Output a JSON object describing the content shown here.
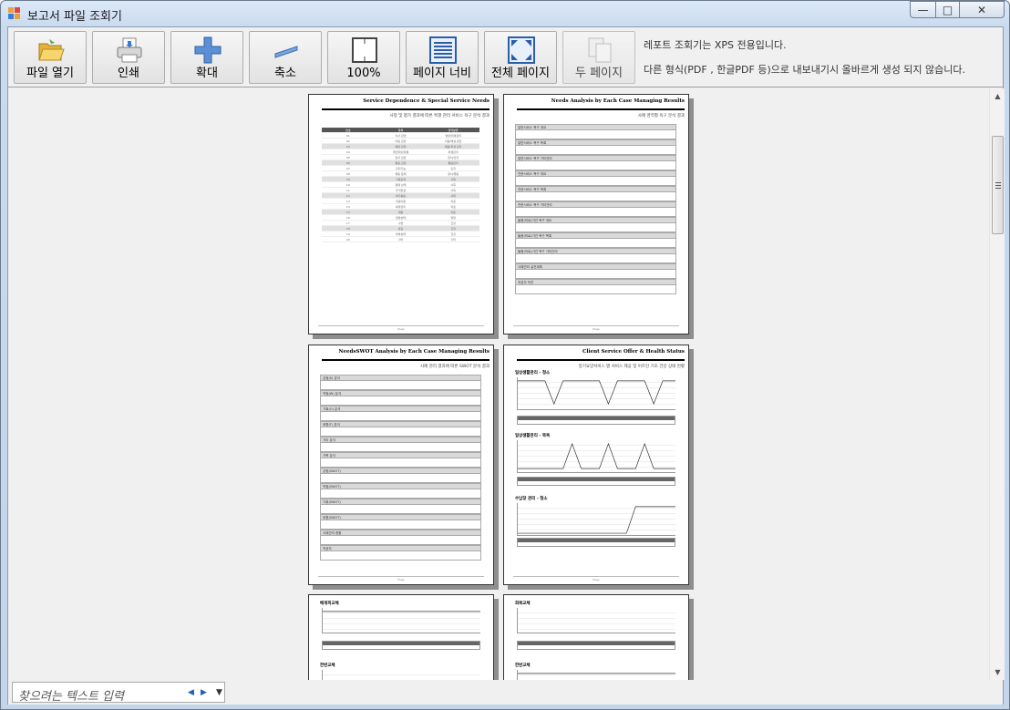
{
  "window": {
    "title": "보고서 파일 조회기",
    "controls": {
      "minimize": "—",
      "maximize": "□",
      "close": "✕"
    }
  },
  "toolbar": {
    "buttons": [
      {
        "label": "파일 열기",
        "icon": "folder-open-icon"
      },
      {
        "label": "인쇄",
        "icon": "printer-icon"
      },
      {
        "label": "확대",
        "icon": "zoom-in-icon"
      },
      {
        "label": "축소",
        "icon": "zoom-out-icon"
      },
      {
        "label": "100%",
        "icon": "actual-size-icon"
      },
      {
        "label": "페이지 너비",
        "icon": "page-width-icon"
      },
      {
        "label": "전체 페이지",
        "icon": "whole-page-icon"
      },
      {
        "label": "두 페이지",
        "icon": "two-pages-icon"
      }
    ],
    "info_line1": "레포트 조회기는 XPS 전용입니다.",
    "info_line2": "다른 형식(PDF , 한글PDF 등)으로 내보내기시 올바르게 생성 되지 않습니다."
  },
  "pages": [
    {
      "title": "Service Dependence & Special Service Needs",
      "subtitle": "사정 및 평가 결과에 따른 특별 관리 서비스 욕구 분석 결과",
      "footer": "Page"
    },
    {
      "title": "Needs Analysis by Each Case Managing Results",
      "subtitle": "사례 영역별 욕구 분석 결과",
      "footer": "Page"
    },
    {
      "title": "NeedsSWOT Analysis by Each Case Managing Results",
      "subtitle": "사례 관리 결과에 따른 SWOT 분석 결과",
      "footer": "Page"
    },
    {
      "title": "Client Service Offer & Health Status",
      "subtitle": "장기요양서비스 별 서비스 제공 및 어르신 기초 건강 상태 현황",
      "footer": "Page"
    }
  ],
  "page1_table": {
    "headers": [
      "번호",
      "항목",
      "영역분류"
    ],
    "rows": [
      [
        "01",
        "식사 관련",
        "영양/위생관리"
      ],
      [
        "02",
        "이동 관련",
        "이동/배설 관련"
      ],
      [
        "03",
        "배변 관련",
        "배설/위생 관리"
      ],
      [
        "04",
        "개인위생/청결",
        "위생관리"
      ],
      [
        "05",
        "정서 관련",
        "정서/인지"
      ],
      [
        "06",
        "통증 관련",
        "통증관리"
      ],
      [
        "07",
        "인지기능",
        "인지"
      ],
      [
        "08",
        "행동 문제",
        "정서/행동"
      ],
      [
        "09",
        "가족관계",
        "사회"
      ],
      [
        "10",
        "경제 상태",
        "사회"
      ],
      [
        "11",
        "주거환경",
        "사회"
      ],
      [
        "12",
        "여가활동",
        "사회"
      ],
      [
        "13",
        "의료이용",
        "의료"
      ],
      [
        "14",
        "복약관리",
        "의료"
      ],
      [
        "15",
        "재활",
        "의료"
      ],
      [
        "16",
        "영양상태",
        "영양"
      ],
      [
        "17",
        "수면",
        "건강"
      ],
      [
        "18",
        "호흡",
        "건강"
      ],
      [
        "19",
        "피부상태",
        "건강"
      ],
      [
        "20",
        "기타",
        "기타"
      ]
    ]
  },
  "page2_fields": [
    "일반서비스 욕구 개요",
    "일반서비스 욕구 목록",
    "일반서비스 욕구 기타관리",
    "전문서비스 욕구 개요",
    "전문서비스 욕구 목록",
    "전문서비스 욕구 기타관리",
    "돌봄(의료)기관 욕구 개요",
    "돌봄(의료)기관 욕구 목록",
    "돌봄(의료)기관 욕구 기타관리",
    "사례관리 실천계획",
    "작성자 의견"
  ],
  "page3_fields": [
    "강점(S) 분석",
    "약점(W) 분석",
    "기회(O) 분석",
    "위협(T) 분석",
    "기타 분석",
    "가족 분석",
    "강점(SWOT)",
    "약점(SWOT)",
    "기회(SWOT)",
    "위협(SWOT)",
    "사례관리 종합",
    "작성자"
  ],
  "page4_sections": [
    "일상생활관리 - 청소",
    "일상생활관리 - 목욕",
    "수납장 관리 - 청소"
  ],
  "page5_sections": [
    "배개피교체",
    "한번교체"
  ],
  "page6_sections": [
    "회복교체",
    "한번교체"
  ],
  "search": {
    "placeholder": "찾으려는 텍스트 입력",
    "prev": "◀",
    "next": "▶",
    "dropdown": "▼"
  },
  "scrollbar": {
    "up": "▲",
    "down": "▼"
  }
}
